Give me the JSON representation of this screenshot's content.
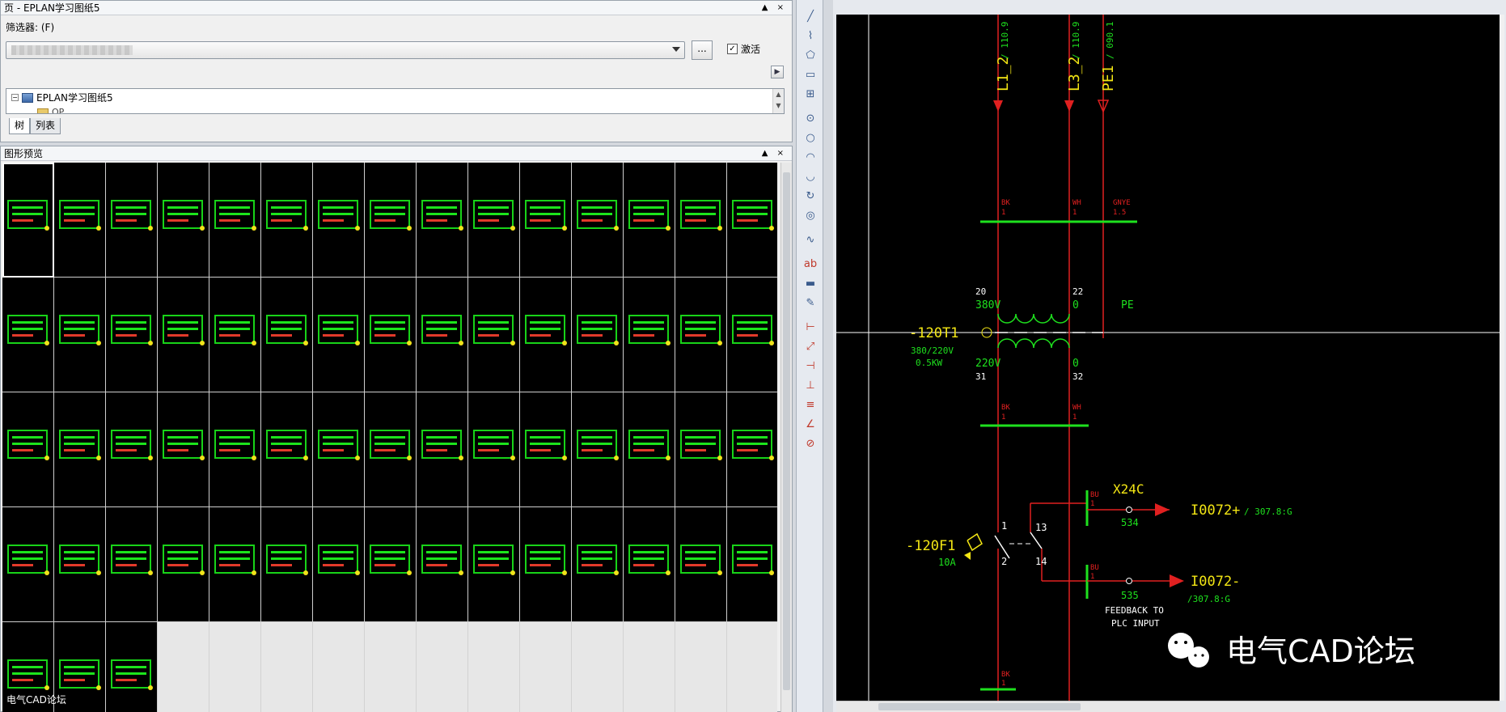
{
  "pages_panel": {
    "title": "页 - EPLAN学习图纸5",
    "filter_label": "筛选器: (F)",
    "more_button": "...",
    "activate_label": "激活",
    "activate_checked": "✓",
    "tree_root": "EPLAN学习图纸5",
    "tree_child": "OP",
    "tabs": [
      "树",
      "列表"
    ]
  },
  "preview_panel": {
    "title": "图形预览"
  },
  "schematic": {
    "wire_l1": "L1_2",
    "wire_l1_ref": "/ 110.9",
    "wire_l3": "L3_2",
    "wire_l3_ref": "/ 110.9",
    "wire_pe": "PE1",
    "wire_pe_ref": "/ 090.1",
    "bk": "BK",
    "wh": "WH",
    "gnye": "GNYE",
    "one": "1",
    "one_five": "1.5",
    "bu": "BU",
    "t_20": "20",
    "t_22": "22",
    "t_31": "31",
    "t_32": "32",
    "v_380": "380V",
    "v_0a": "0",
    "pe_label": "PE",
    "v_220": "220V",
    "v_0b": "0",
    "transformer_tag": "-120T1",
    "transformer_rating": "380/220V",
    "transformer_power": "0.5KW",
    "fuse_tag": "-120F1",
    "fuse_rating": "10A",
    "sw_1": "1",
    "sw_2": "2",
    "sw_13": "13",
    "sw_14": "14",
    "terminal_tag": "X24C",
    "terminal_534": "534",
    "terminal_535": "535",
    "io_plus": "I0072+",
    "io_plus_ref": "/ 307.8:G",
    "io_minus": "I0072-",
    "io_minus_ref": "/307.8:G",
    "feedback_1": "FEEDBACK TO",
    "feedback_2": "PLC INPUT"
  },
  "watermark": {
    "text": "电气CAD论坛",
    "small_text": "电气CAD论坛"
  },
  "colors": {
    "wire_red": "#e02020",
    "green": "#1ee11e",
    "yellow": "#f3e614",
    "white": "#ffffff"
  }
}
